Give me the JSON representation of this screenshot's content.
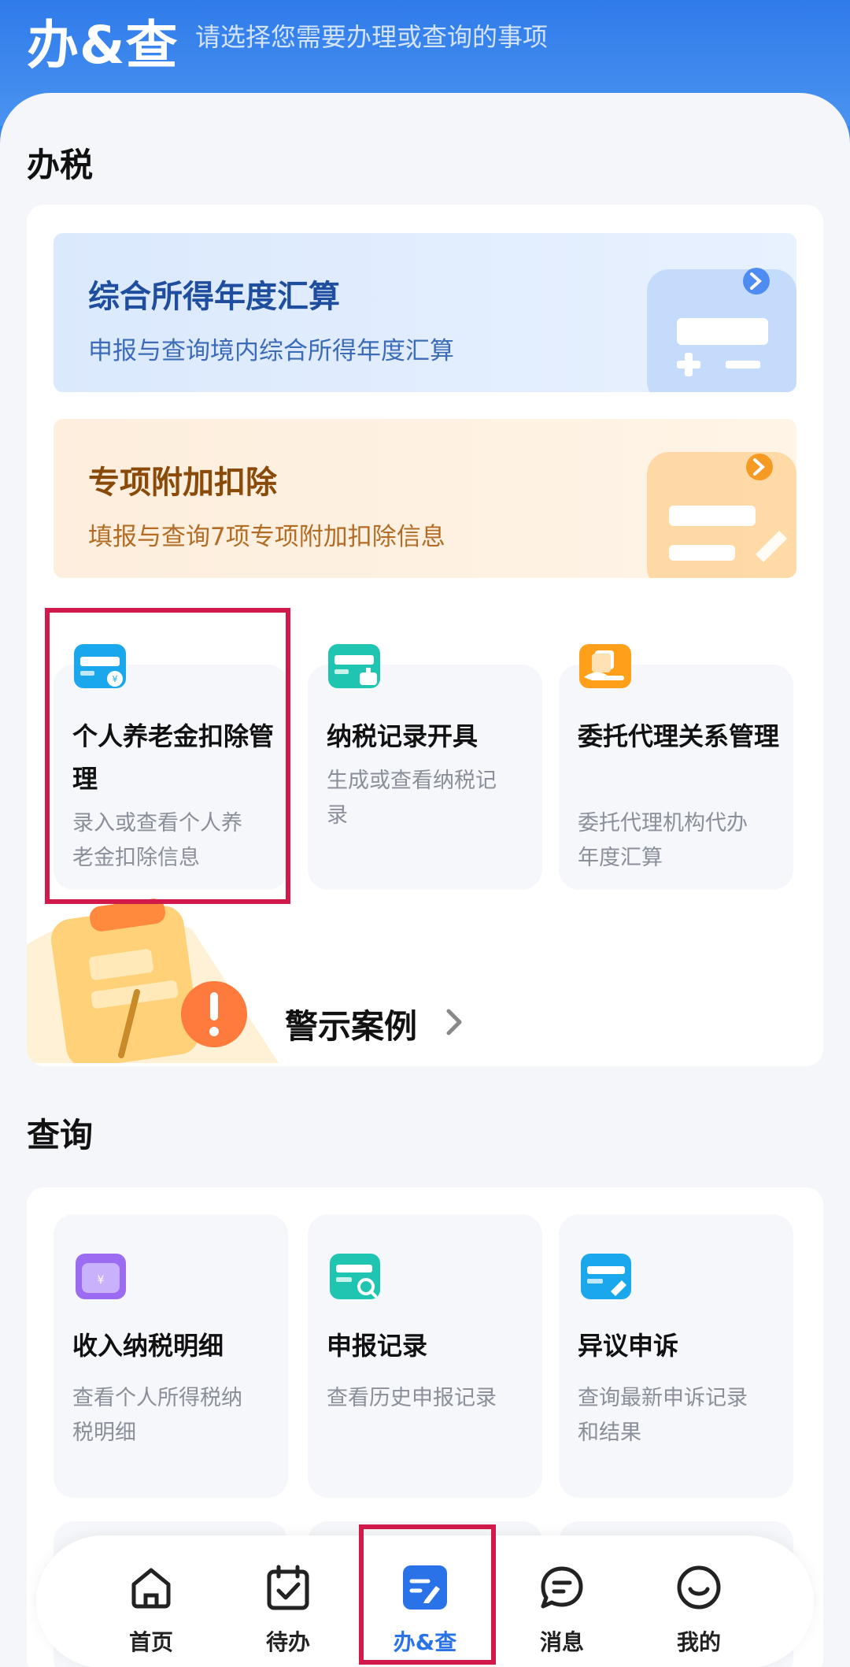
{
  "header": {
    "title": "办&查",
    "subtitle": "请选择您需要办理或查询的事项"
  },
  "sections": {
    "tax": {
      "title": "办税",
      "banners": [
        {
          "title": "综合所得年度汇算",
          "subtitle": "申报与查询境内综合所得年度汇算",
          "color": "#2f6fd6"
        },
        {
          "title": "专项附加扣除",
          "subtitle": "填报与查询7项专项附加扣除信息",
          "color": "#f59a23"
        }
      ],
      "tiles": [
        {
          "title": "个人养老金扣除管理",
          "subtitle": "录入或查看个人养老金扣除信息",
          "icon": "pension-card-icon"
        },
        {
          "title": "纳税记录开具",
          "subtitle": "生成或查看纳税记录",
          "icon": "tax-record-icon"
        },
        {
          "title": "委托代理关系管理",
          "subtitle": "委托代理机构代办年度汇算",
          "icon": "agency-icon"
        }
      ],
      "warning": {
        "label": "警示案例"
      }
    },
    "query": {
      "title": "查询",
      "tiles": [
        {
          "title": "收入纳税明细",
          "subtitle": "查看个人所得税纳税明细",
          "icon": "income-detail-icon"
        },
        {
          "title": "申报记录",
          "subtitle": "查看历史申报记录",
          "icon": "declare-record-icon"
        },
        {
          "title": "异议申诉",
          "subtitle": "查询最新申诉记录和结果",
          "icon": "appeal-icon"
        }
      ]
    }
  },
  "nav": {
    "items": [
      {
        "label": "首页",
        "icon": "home-icon"
      },
      {
        "label": "待办",
        "icon": "todo-calendar-icon"
      },
      {
        "label": "办&查",
        "icon": "handle-query-icon",
        "active": true
      },
      {
        "label": "消息",
        "icon": "message-icon"
      },
      {
        "label": "我的",
        "icon": "smile-profile-icon"
      }
    ]
  },
  "colors": {
    "brand": "#2f7bea",
    "highlight": "#d21a4a",
    "active_nav": "#2a72e8"
  }
}
